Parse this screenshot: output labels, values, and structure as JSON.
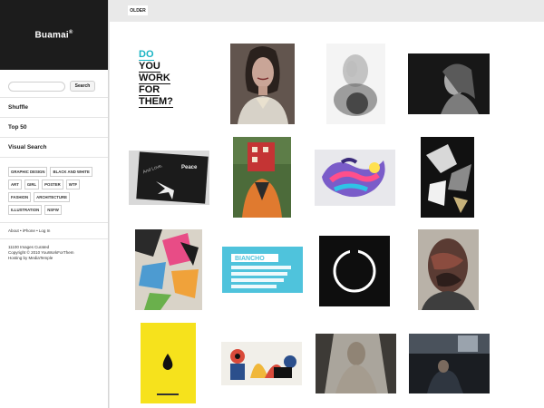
{
  "brand": {
    "name": "Buamai",
    "mark": "®"
  },
  "search": {
    "placeholder": "",
    "button": "Search"
  },
  "nav": [
    "Shuffle",
    "Top 50",
    "Visual Search"
  ],
  "tags": [
    "GRAPHIC DESIGN",
    "BLACK AND WHITE",
    "ART",
    "GIRL",
    "POSTER",
    "WTF",
    "FASHION",
    "ARCHITECTURE",
    "ILLUSTRATION",
    "NSFW"
  ],
  "footer_links": "About • iPhone • Log In",
  "footer_info": [
    "11100 Images Curated",
    "Copyright © 2010 YouWorkForThem",
    "Hosting by MediaTemple"
  ],
  "top_bar": {
    "older": "OLDER"
  },
  "featured_text": [
    "DO",
    "YOU",
    "WORK",
    "FOR",
    "THEM?"
  ],
  "accent": "#19b4c4",
  "thumbnails": [
    "fashion-portrait-woman",
    "blurred-figure-bw",
    "woman-portrait-bw",
    "book-cover-peace",
    "red-house-head-illustration",
    "abstract-paint-swirl",
    "broken-geometry-bw",
    "geometric-collage-pink",
    "type-specimen-cyan",
    "circle-on-black",
    "distorted-face-collage",
    "yellow-poster-drop",
    "geometric-figures-illustration",
    "veiled-figure-photo",
    "dark-room-photo"
  ]
}
